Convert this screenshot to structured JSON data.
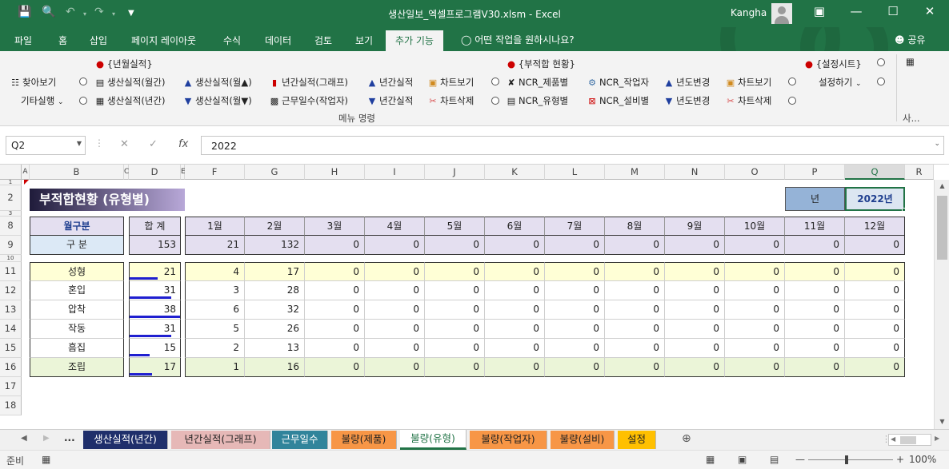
{
  "window": {
    "title": "생산일보_엑셀프로그램V30.xlsm - Excel",
    "user": "Kangha"
  },
  "quick_access": [
    "save-icon",
    "print-preview-icon",
    "undo-icon",
    "redo-icon",
    "customize-icon"
  ],
  "ribbon_tabs": [
    "파일",
    "홈",
    "삽입",
    "페이지 레이아웃",
    "수식",
    "데이터",
    "검토",
    "보기",
    "추가 기능"
  ],
  "active_tab": "추가 기능",
  "tell_me": "어떤 작업을 원하시나요?",
  "share": "공유",
  "ribbon": {
    "group_label": "메뉴 명령",
    "find": "찾아보기",
    "run_other": "기타실행",
    "section_yearmonth": "{년월실적}",
    "prod_monthly": "생산실적(월간)",
    "prod_yearly": "생산실적(년간)",
    "prod_month_up": "생산실적(월▲)",
    "prod_month_down": "생산실적(월▼)",
    "year_graph": "년간실적(그래프)",
    "work_days": "근무일수(작업자)",
    "year_up": "년간실적",
    "year_down": "년간실적",
    "chart_view_1": "차트보기",
    "chart_delete_1": "차트삭제",
    "section_defect": "{부적합 현황}",
    "ncr_product": "NCR_제품별",
    "ncr_type": "NCR_유형별",
    "ncr_worker": "NCR_작업자",
    "ncr_equipment": "NCR_설비별",
    "year_change_up": "년도변경",
    "year_change_down": "년도변경",
    "chart_view_2": "차트보기",
    "chart_delete_2": "차트삭제",
    "section_settings": "{설정시트}",
    "settings": "설정하기",
    "collapsed_label": "사..."
  },
  "formula_bar": {
    "name_box": "Q2",
    "formula": "2022"
  },
  "columns": [
    "A",
    "B",
    "C",
    "D",
    "E",
    "F",
    "G",
    "H",
    "I",
    "J",
    "K",
    "L",
    "M",
    "N",
    "O",
    "P",
    "Q",
    "R"
  ],
  "rows": [
    "1",
    "2",
    "3",
    "8",
    "9",
    "10",
    "11",
    "12",
    "13",
    "14",
    "15",
    "16",
    "17",
    "18"
  ],
  "sheet": {
    "title": "부적합현황 (유형별)",
    "year_label": "년",
    "year_value": "2022년",
    "header_category": "월구분",
    "header_sub": "구  분",
    "header_total": "합  계",
    "grand_total": "153",
    "months": [
      "1월",
      "2월",
      "3월",
      "4월",
      "5월",
      "6월",
      "7월",
      "8월",
      "9월",
      "10월",
      "11월",
      "12월"
    ],
    "month_totals": [
      "21",
      "132",
      "0",
      "0",
      "0",
      "0",
      "0",
      "0",
      "0",
      "0",
      "0",
      "0"
    ],
    "defect_rows": [
      {
        "name": "성형",
        "total": "21",
        "bar": 0.55,
        "months": [
          "4",
          "17",
          "0",
          "0",
          "0",
          "0",
          "0",
          "0",
          "0",
          "0",
          "0",
          "0"
        ]
      },
      {
        "name": "혼입",
        "total": "31",
        "bar": 0.82,
        "months": [
          "3",
          "28",
          "0",
          "0",
          "0",
          "0",
          "0",
          "0",
          "0",
          "0",
          "0",
          "0"
        ]
      },
      {
        "name": "압착",
        "total": "38",
        "bar": 1.0,
        "months": [
          "6",
          "32",
          "0",
          "0",
          "0",
          "0",
          "0",
          "0",
          "0",
          "0",
          "0",
          "0"
        ]
      },
      {
        "name": "작동",
        "total": "31",
        "bar": 0.82,
        "months": [
          "5",
          "26",
          "0",
          "0",
          "0",
          "0",
          "0",
          "0",
          "0",
          "0",
          "0",
          "0"
        ]
      },
      {
        "name": "흠집",
        "total": "15",
        "bar": 0.39,
        "months": [
          "2",
          "13",
          "0",
          "0",
          "0",
          "0",
          "0",
          "0",
          "0",
          "0",
          "0",
          "0"
        ]
      },
      {
        "name": "조립",
        "total": "17",
        "bar": 0.45,
        "months": [
          "1",
          "16",
          "0",
          "0",
          "0",
          "0",
          "0",
          "0",
          "0",
          "0",
          "0",
          "0"
        ]
      }
    ]
  },
  "sheet_tabs": [
    {
      "label": "생산실적(년간)",
      "bg": "#1f2f6b",
      "fg": "#ffffff"
    },
    {
      "label": "년간실적(그래프)",
      "bg": "#e6b8b7",
      "fg": "#222222"
    },
    {
      "label": "근무일수",
      "bg": "#31849b",
      "fg": "#ffffff"
    },
    {
      "label": "불량(제품)",
      "bg": "#f79646",
      "fg": "#222222"
    },
    {
      "label": "불량(유형)",
      "bg": "#ffffff",
      "fg": "#217346"
    },
    {
      "label": "불량(작업자)",
      "bg": "#f79646",
      "fg": "#222222"
    },
    {
      "label": "불량(설비)",
      "bg": "#f79646",
      "fg": "#222222"
    },
    {
      "label": "설정",
      "bg": "#ffc000",
      "fg": "#222222"
    }
  ],
  "sheet_nav_more": "...",
  "status": {
    "mode": "준비",
    "zoom": "100%"
  },
  "colors": {
    "excel_green": "#217346",
    "title_gradient_from": "#1f1b3a",
    "title_gradient_to": "#b8a8d8",
    "header_lavender": "#e4dff0",
    "row_yellow": "#ffffd6",
    "row_green": "#ebf5d8",
    "data_bar": "#1f1fd0",
    "year_box": "#95b3d7"
  }
}
